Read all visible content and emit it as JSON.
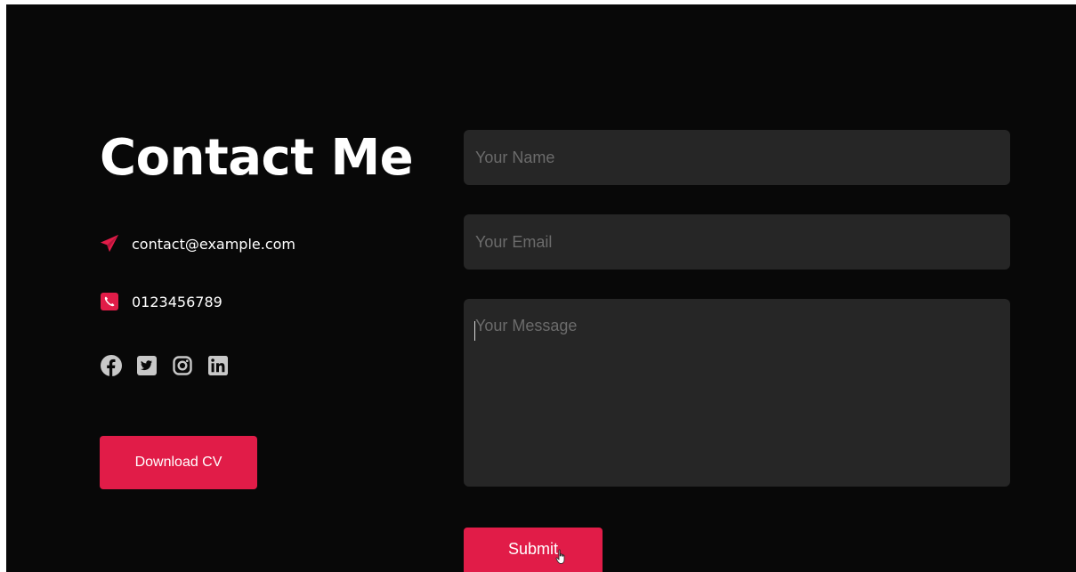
{
  "contact": {
    "title": "Contact Me",
    "email": "contact@example.com",
    "phone": "0123456789",
    "socials": [
      {
        "name": "facebook",
        "icon": "facebook-icon"
      },
      {
        "name": "twitter",
        "icon": "twitter-icon"
      },
      {
        "name": "instagram",
        "icon": "instagram-icon"
      },
      {
        "name": "linkedin",
        "icon": "linkedin-icon"
      }
    ],
    "download_label": "Download CV"
  },
  "form": {
    "name_placeholder": "Your Name",
    "email_placeholder": "Your Email",
    "message_placeholder": "Your Message",
    "submit_label": "Submit"
  },
  "colors": {
    "background": "#080808",
    "accent": "#e11c48",
    "field": "#262626",
    "icon": "#c8c8c8"
  }
}
